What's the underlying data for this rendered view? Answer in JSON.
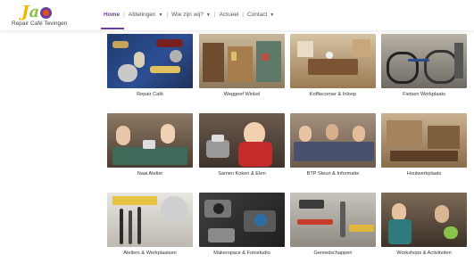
{
  "brand": {
    "logo_letter_1": "J",
    "logo_letter_2": "a",
    "logo_text": "Repair Café Tevingen",
    "colors": {
      "accent": "#6a3f9e",
      "logo_orange": "#e94e1b",
      "logo_green": "#8bc34a",
      "logo_yellow": "#f5b400"
    }
  },
  "nav": {
    "items": [
      {
        "label": "Home",
        "active": true,
        "dropdown": false
      },
      {
        "label": "Afdelingen",
        "active": false,
        "dropdown": true
      },
      {
        "label": "Wie zijn wij?",
        "active": false,
        "dropdown": true
      },
      {
        "label": "Actueel",
        "active": false,
        "dropdown": false
      },
      {
        "label": "Contact",
        "active": false,
        "dropdown": true
      }
    ],
    "dropdown_icon": "caret-down-icon",
    "separator": "|"
  },
  "tiles": [
    {
      "caption": "Repair Café",
      "photo": "electronic-components"
    },
    {
      "caption": "Weggeef Winkel",
      "photo": "shop-interior"
    },
    {
      "caption": "Koffiecorner & Inloop",
      "photo": "coffee-corner"
    },
    {
      "caption": "Fietsen Werkplaats",
      "photo": "bicycles"
    },
    {
      "caption": "Naai Atelier",
      "photo": "sewing-workshop"
    },
    {
      "caption": "Samen Koken & Eten",
      "photo": "cooking"
    },
    {
      "caption": "BTP Steun & Informatie",
      "photo": "group-meeting"
    },
    {
      "caption": "Houtwerkplaats",
      "photo": "wood-workshop"
    },
    {
      "caption": "Ateliers & Werkplaatsen",
      "photo": "paint-brushes"
    },
    {
      "caption": "Makerspace & Fotostudio",
      "photo": "cameras"
    },
    {
      "caption": "Gereedschappen",
      "photo": "tools"
    },
    {
      "caption": "Workshops & Activiteiten",
      "photo": "workshop-activity"
    }
  ]
}
